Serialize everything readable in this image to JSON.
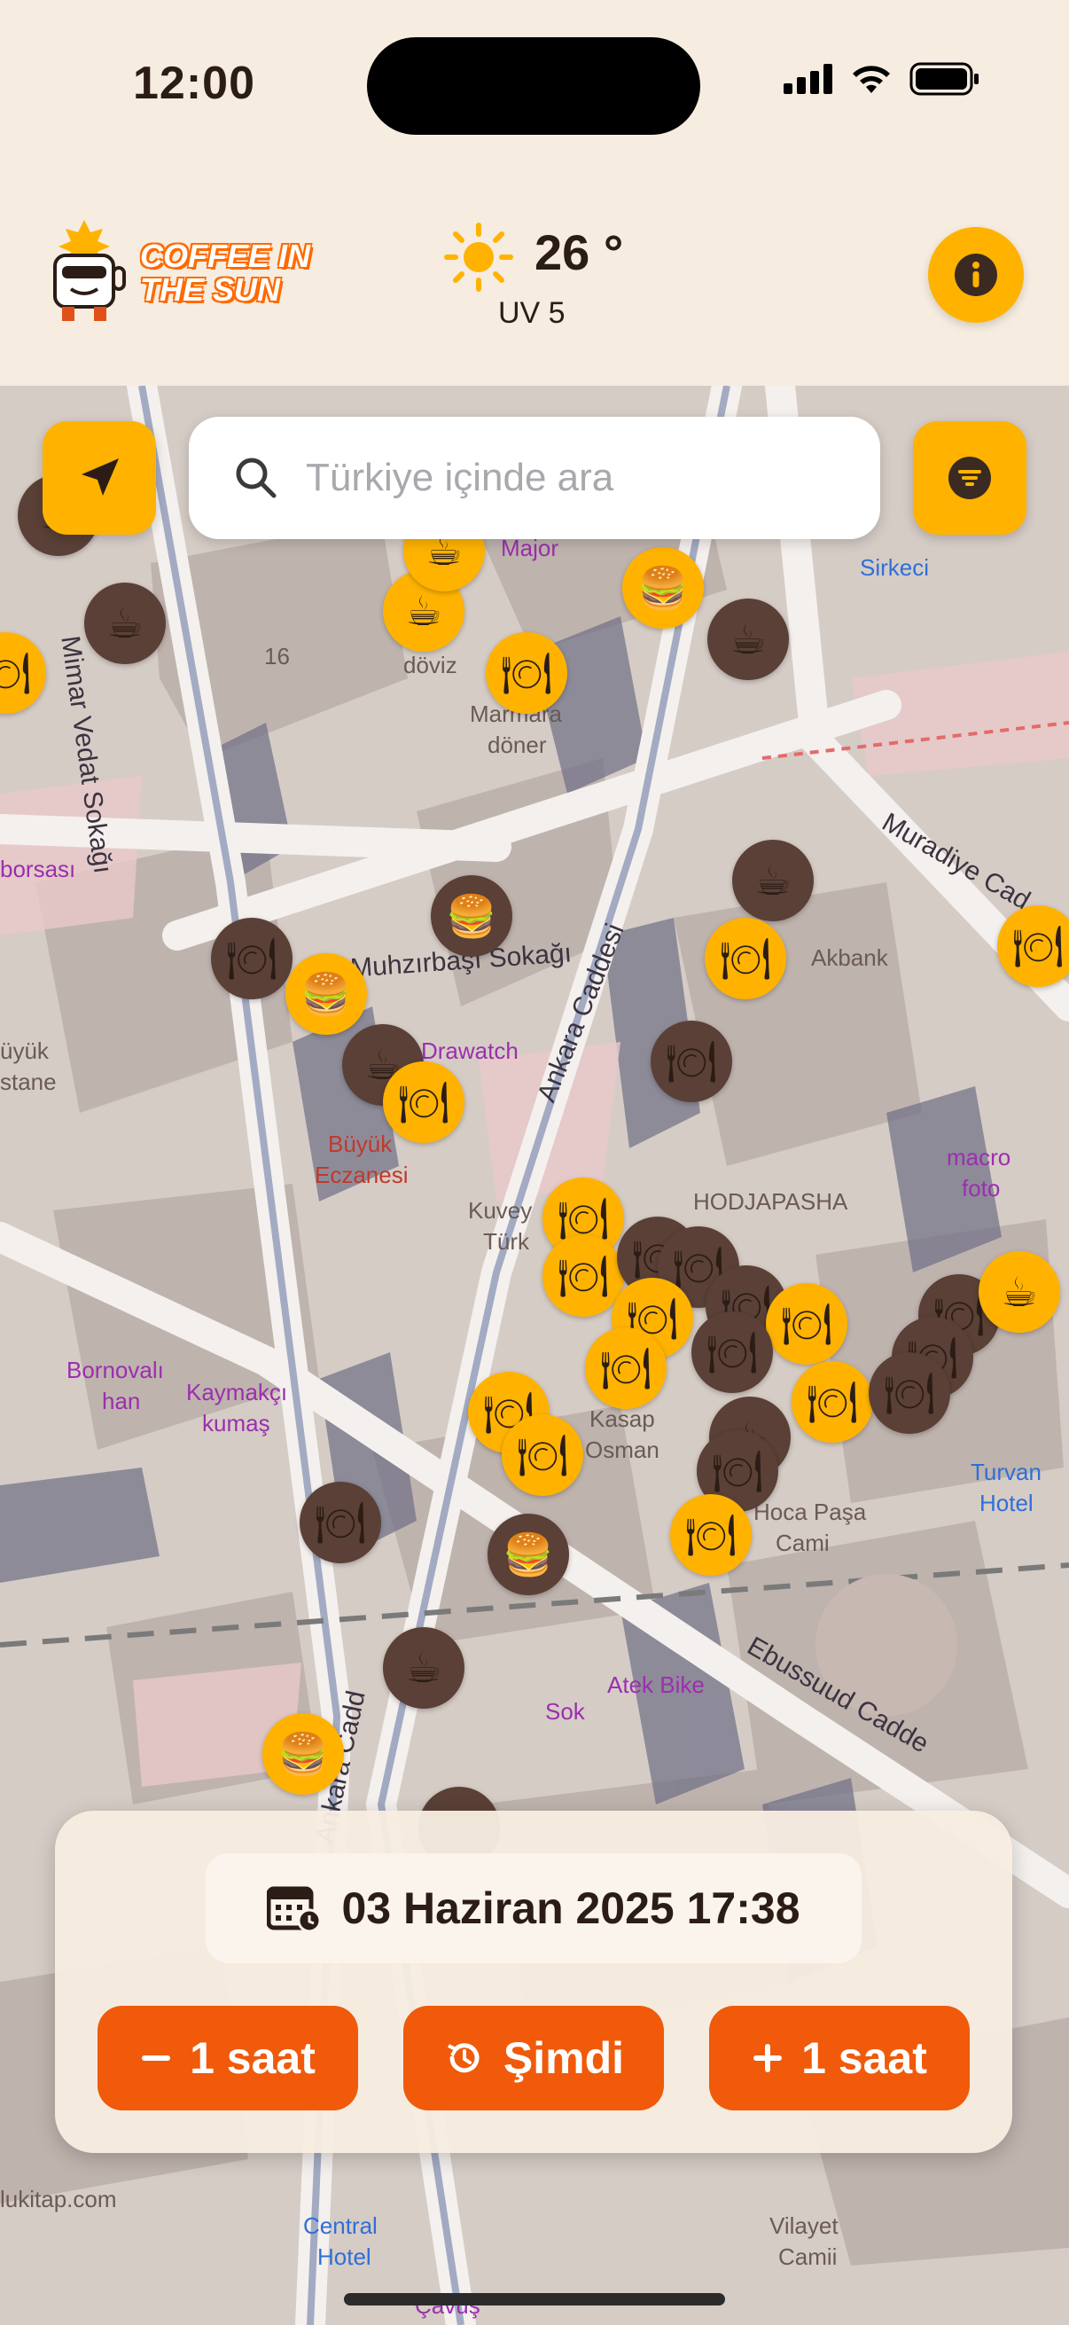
{
  "status_bar": {
    "time": "12:00"
  },
  "header": {
    "logo_text_line1": "COFFEE IN",
    "logo_text_line2": "THE SUN",
    "temperature": "26 °",
    "uv": "UV 5"
  },
  "search": {
    "placeholder": "Türkiye içinde ara"
  },
  "map_labels": {
    "mimar": "Mimar Vedat Sokağı",
    "muhzirbasi": "Muhzırbaşı Sokağı",
    "ankara": "Ankara Caddesi",
    "ankara2": "Ankara Cadd",
    "muradiye": "Muradiye Cad",
    "ebussuud": "Ebussuud Cadde",
    "sirkeci": "Sirkeci",
    "major": "Major",
    "num16": "16",
    "doviz": "döviz",
    "marmara": "Marmara",
    "doner": "döner",
    "akbank": "Akbank",
    "borsasi": "borsası",
    "uyuk": "üyük",
    "stane": "stane",
    "drawatch": "Drawatch",
    "buyuk": "Büyük",
    "eczanesi": "Eczanesi",
    "kuvey": "Kuvey",
    "turk": "Türk",
    "hodjapasha": "HODJAPASHA",
    "macro": "macro",
    "foto": "foto",
    "bornovali": "Bornovalı",
    "han": "han",
    "kaymakci": "Kaymakçı",
    "kumas": "kumaş",
    "kasap": "Kasap",
    "osman": "Osman",
    "hocapasa": "Hoca Paşa",
    "cami": "Cami",
    "turvan": "Turvan",
    "hotel": "Hotel",
    "atekbike": "Atek Bike",
    "sok": "Sok",
    "lukitap": "lukitap.com",
    "central": "Central",
    "centralhotel": "Hotel",
    "vilayet": "Vilayet",
    "camii": "Camii",
    "cavus": "Çavuş"
  },
  "time_panel": {
    "datetime": "03 Haziran 2025 17:38",
    "minus_label": "1 saat",
    "now_label": "Şimdi",
    "plus_label": "1 saat"
  },
  "colors": {
    "accent": "#ffb300",
    "button": "#f05a0a",
    "shade_marker": "#5a4036",
    "background": "#f6ece0"
  },
  "icons": {
    "cafe": "☕",
    "restaurant": "🍽",
    "burger": "🍔"
  }
}
